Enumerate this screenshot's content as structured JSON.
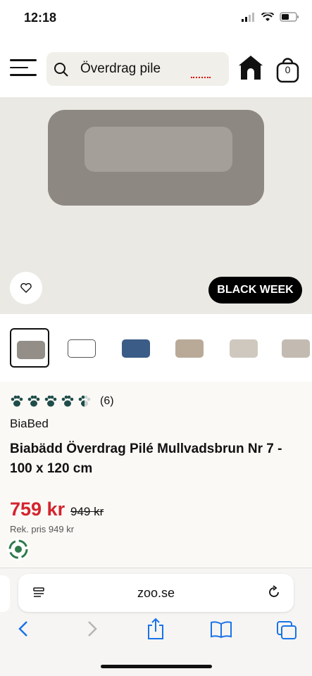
{
  "status": {
    "time": "12:18"
  },
  "header": {
    "search_query": "Överdrag pile",
    "cart_count": "0"
  },
  "hero": {
    "badge": "BLACK WEEK"
  },
  "product": {
    "review_count": "(6)",
    "rating": 4.5,
    "brand": "BiaBed",
    "title": "Biabädd Överdrag Pilé Mullvadsbrun Nr 7 - 100 x 120 cm",
    "price": "759 kr",
    "old_price": "949 kr",
    "recommended_price": "Rek. pris 949 kr"
  },
  "browser": {
    "url": "zoo.se"
  },
  "colors": {
    "price": "#d4242f",
    "badge_bg": "#000000",
    "paw": "#1f4d4a"
  }
}
